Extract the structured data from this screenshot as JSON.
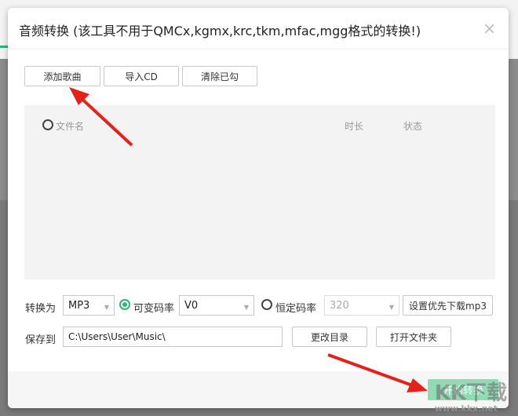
{
  "dialog": {
    "title": "音频转换 (该工具不用于QMCx,kgmx,krc,tkm,mfac,mgg格式的转换!)",
    "close": "×"
  },
  "toolbar": {
    "add": "添加歌曲",
    "import_cd": "导入CD",
    "clear": "清除已勾"
  },
  "list": {
    "col_name": "文件名",
    "col_duration": "时长",
    "col_status": "状态"
  },
  "convert": {
    "label": "转换为",
    "format": "MP3",
    "vbr_label": "可变码率",
    "vbr_value": "V0",
    "cbr_label": "恒定码率",
    "cbr_value": "320",
    "prefer_mp3": "设置优先下载mp3",
    "vbr_selected": true
  },
  "save": {
    "label": "保存到",
    "path": "C:\\Users\\User\\Music\\",
    "change_dir": "更改目录",
    "open_folder": "打开文件夹"
  },
  "footer": {
    "start": "开始转换"
  },
  "watermark": {
    "logo": "KK下载",
    "url": "www.kkx.net"
  },
  "colors": {
    "accent": "#2bb673",
    "arrow": "#e8201c"
  }
}
